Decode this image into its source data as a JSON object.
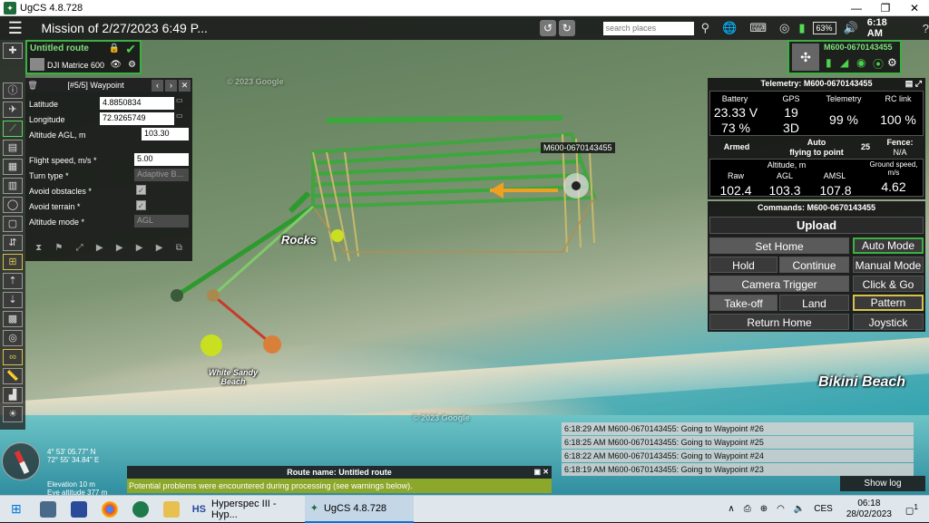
{
  "window": {
    "title": "UgCS 4.8.728",
    "minimize": "—",
    "maximize": "❐",
    "close": "✕"
  },
  "topbar": {
    "mission_title": "Mission of 2/27/2023 6:49 P...",
    "search_placeholder": "search places",
    "battery_percent": "63%",
    "clock": "6:18 AM"
  },
  "route_card": {
    "name": "Untitled route",
    "drone": "DJI Matrice 600"
  },
  "waypoint_panel": {
    "title": "[#5/5] Waypoint",
    "latitude_label": "Latitude",
    "latitude": "4.8850834",
    "longitude_label": "Longitude",
    "longitude": "72.9265749",
    "altitude_label": "Altitude AGL, m",
    "altitude": "103.30",
    "speed_label": "Flight speed, m/s *",
    "speed": "5.00",
    "turn_label": "Turn type *",
    "turn": "Adaptive B...",
    "obstacles_label": "Avoid obstacles *",
    "terrain_label": "Avoid terrain *",
    "altmode_label": "Altitude mode *",
    "altmode": "AGL"
  },
  "vehicle_card": {
    "name": "M600-0670143455"
  },
  "telemetry": {
    "title": "Telemetry: M600-0670143455",
    "battery_label": "Battery",
    "battery_v": "23.33 V",
    "battery_pc": "73 %",
    "gps_label": "GPS",
    "gps_sats": "19",
    "gps_fix": "3D",
    "telemetry_label": "Telemetry",
    "telemetry_val": "99 %",
    "rc_label": "RC link",
    "rc_val": "100 %",
    "armed": "Armed",
    "mode_line1": "Auto",
    "mode_line2": "flying to point",
    "point": "25",
    "fence_label": "Fence:",
    "fence": "N/A",
    "alt_label": "Altitude, m",
    "raw_label": "Raw",
    "raw": "102.4",
    "agl_label": "AGL",
    "agl": "103.3",
    "amsl_label": "AMSL",
    "amsl": "107.8",
    "gs_label": "Ground speed,",
    "gs_unit": "m/s",
    "gs": "4.62"
  },
  "commands": {
    "title": "Commands: M600-0670143455",
    "upload": "Upload",
    "set_home": "Set Home",
    "auto_mode": "Auto Mode",
    "hold": "Hold",
    "continue": "Continue",
    "manual_mode": "Manual Mode",
    "camera_trigger": "Camera Trigger",
    "click_go": "Click & Go",
    "takeoff": "Take-off",
    "land": "Land",
    "pattern": "Pattern",
    "return_home": "Return Home",
    "joystick": "Joystick"
  },
  "map": {
    "drone_label": "M600-0670143455",
    "rocks": "Rocks",
    "white_sandy_1": "White Sandy",
    "white_sandy_2": "Beach",
    "bikini": "Bikini Beach",
    "google1": "© 2023 Google",
    "google2": "© 2023 Google"
  },
  "log": [
    "6:18:29 AM   M600-0670143455: Going to Waypoint #26",
    "6:18:25 AM   M600-0670143455: Going to Waypoint #25",
    "6:18:22 AM   M600-0670143455: Going to Waypoint #24",
    "6:18:19 AM   M600-0670143455: Going to Waypoint #23"
  ],
  "show_log": "Show log",
  "route_bar": "Route name: Untitled route",
  "warning": "Potential problems were encountered during processing (see warnings below).",
  "coords": {
    "lat": "4° 53' 05.77\" N",
    "lon": "72° 55' 34.84\" E",
    "elev": "Elevation 10 m",
    "eye": "Eye altitude 377 m"
  },
  "taskbar": {
    "app1": "Hyperspec III - Hyp...",
    "app2": "UgCS 4.8.728",
    "lang": "CES",
    "time": "06:18",
    "date": "28/02/2023",
    "notif": "1"
  },
  "colors": {
    "accent_green": "#3cb043",
    "highlight_yellow": "#d8c24a",
    "warning_bar": "#96aa1e"
  }
}
